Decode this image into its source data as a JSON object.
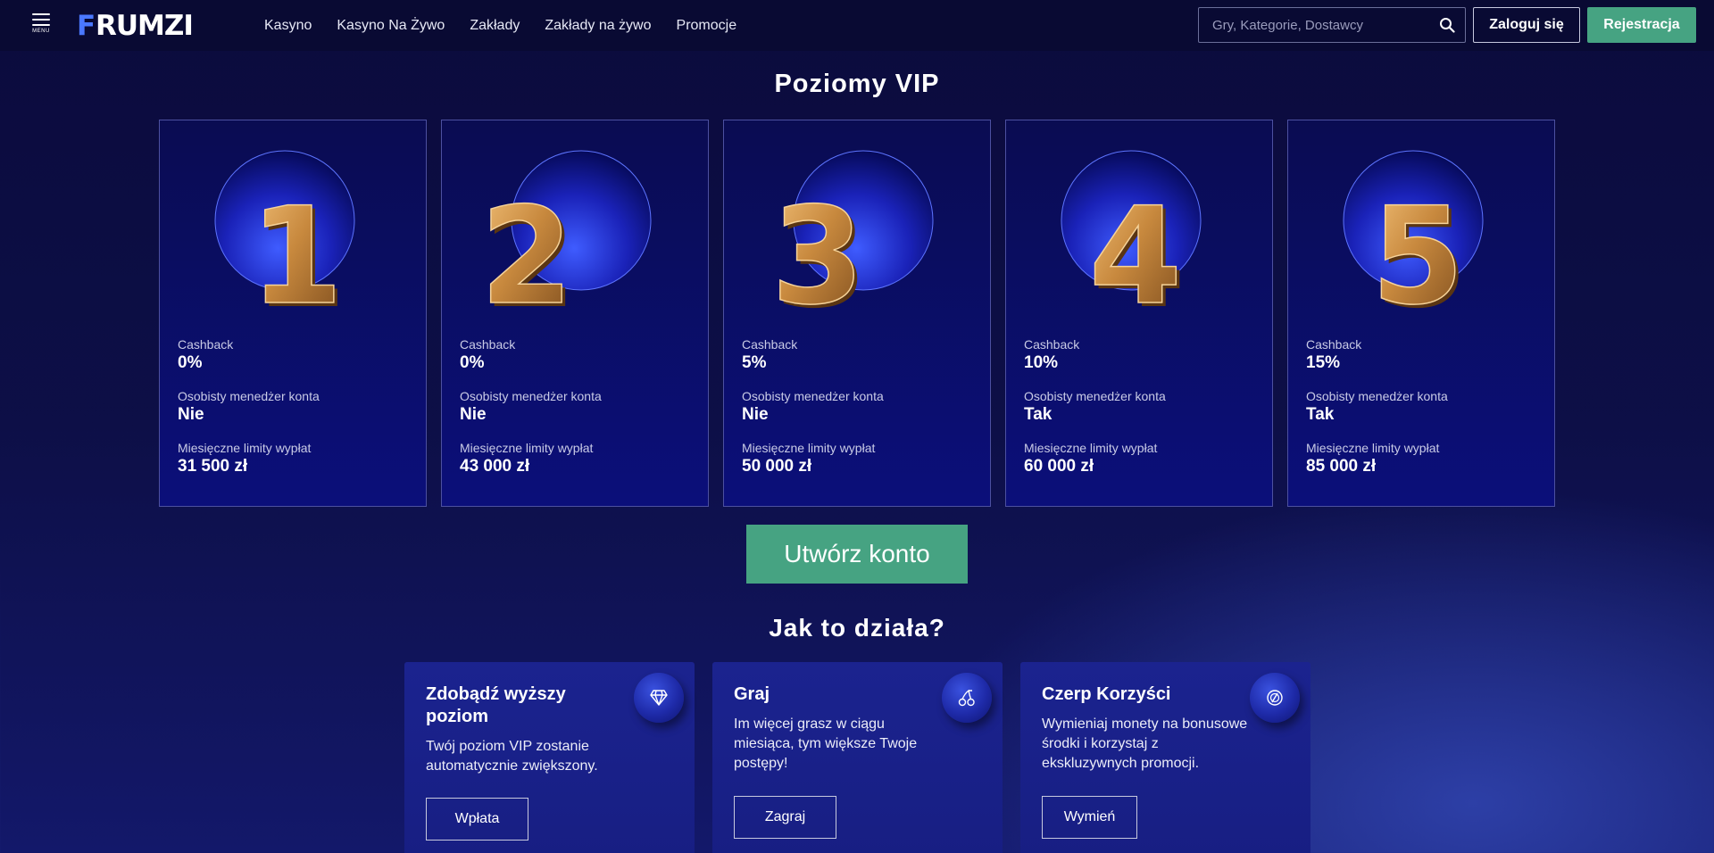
{
  "header": {
    "menu_label": "MENU",
    "logo_text": "FRUMZI",
    "nav": [
      {
        "label": "Kasyno"
      },
      {
        "label": "Kasyno Na Żywo"
      },
      {
        "label": "Zakłady"
      },
      {
        "label": "Zakłady na żywo"
      },
      {
        "label": "Promocje"
      }
    ],
    "search_placeholder": "Gry, Kategorie, Dostawcy",
    "login_label": "Zaloguj się",
    "register_label": "Rejestracja"
  },
  "vip": {
    "title": "Poziomy VIP",
    "cashback_label": "Cashback",
    "manager_label": "Osobisty menedżer konta",
    "limits_label": "Miesięczne limity wypłat",
    "levels": [
      {
        "number": "1",
        "cashback": "0%",
        "manager": "Nie",
        "limit": "31 500 zł"
      },
      {
        "number": "2",
        "cashback": "0%",
        "manager": "Nie",
        "limit": "43 000 zł"
      },
      {
        "number": "3",
        "cashback": "5%",
        "manager": "Nie",
        "limit": "50 000 zł"
      },
      {
        "number": "4",
        "cashback": "10%",
        "manager": "Tak",
        "limit": "60 000 zł"
      },
      {
        "number": "5",
        "cashback": "15%",
        "manager": "Tak",
        "limit": "85 000 zł"
      }
    ],
    "create_button": "Utwórz konto"
  },
  "how": {
    "title": "Jak to działa?",
    "steps": [
      {
        "title": "Zdobądź wyższy poziom",
        "text": "Twój poziom VIP zostanie automatycznie zwiększony.",
        "button": "Wpłata",
        "icon": "diamond-icon"
      },
      {
        "title": "Graj",
        "text": "Im więcej grasz w ciągu miesiąca, tym większe Twoje postępy!",
        "button": "Zagraj",
        "icon": "cherry-icon"
      },
      {
        "title": "Czerp Korzyści",
        "text": "Wymieniaj monety na bonusowe środki i korzystaj z ekskluzywnych promocji.",
        "button": "Wymień",
        "icon": "coin-icon"
      }
    ]
  },
  "colors": {
    "accent_green": "#46a382",
    "logo_blue": "#4a78ff",
    "background": "#0d0f47",
    "gold": "#c8893e"
  }
}
